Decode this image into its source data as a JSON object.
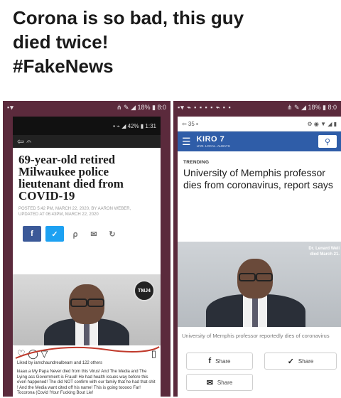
{
  "caption": {
    "line1": "Corona is so bad, this guy",
    "line2": "died twice!",
    "line3": "#FakeNews"
  },
  "left_phone": {
    "status_left": "▪▾",
    "status_right": "⋔ ✎ ◢ 18% ▮ 8:0",
    "inner_status": "▪ ⌁ ◢ 42% ▮ 1:31",
    "back_label": "⇦ 𝄐",
    "headline": "69-year-old retired Milwaukee police lieutenant died from COVID-19",
    "posted_line1": "POSTED 5:42 PM, MARCH 22, 2020, BY AARON WEBER,",
    "posted_line2": "UPDATED AT 06:43PM, MARCH 22, 2020",
    "share_fb": "f",
    "share_tw": "✓",
    "share_pin": "⍴",
    "share_mail": "✉",
    "share_print": "↻",
    "badge_text": "TMJ4",
    "likes": "Liked by iamchaundrealbeam and 122 others",
    "comment": "kiaao.a My Papa Never died from this Virus! And The Media and The Lying ass Government is Fraud! He had health issues way before this even happened! The did NOT confirm with our family that he had that shit ! And the Media want cited off his name! This is going tooooo Far! Tocorona (Covid !Your Fucking Bout Lie!"
  },
  "right_phone": {
    "status_left": "▪▾ ⌁ ▪ ▪ ▪ ▪ ⌁ ▪ ▪",
    "status_right": "⋔ ✎ ◢ 18% ▮ 8:0",
    "inner_status_left": "⇦ 35 ▪",
    "inner_status_right": "⚙ ◉ ▼ ◢ ▮",
    "logo": "KIRO 7",
    "logo_sub": "LIVE. LOCAL. ALWAYS",
    "search_icon": "⚲",
    "trending": "TRENDING",
    "headline": "University of Memphis professor dies from coronavirus, report says",
    "overlay_name": "Dr. Lenard Weli",
    "overlay_date": "died March 21.",
    "caption": "University of Memphis professor reportedly dies of coronavirus",
    "share1_label": "Share",
    "share2_label": "Share",
    "share3_label": "Share"
  },
  "colors": {
    "phone_frame": "#5b2a3c",
    "kiro_blue": "#2f5da8",
    "facebook": "#3b5998",
    "twitter": "#1da1f2"
  }
}
